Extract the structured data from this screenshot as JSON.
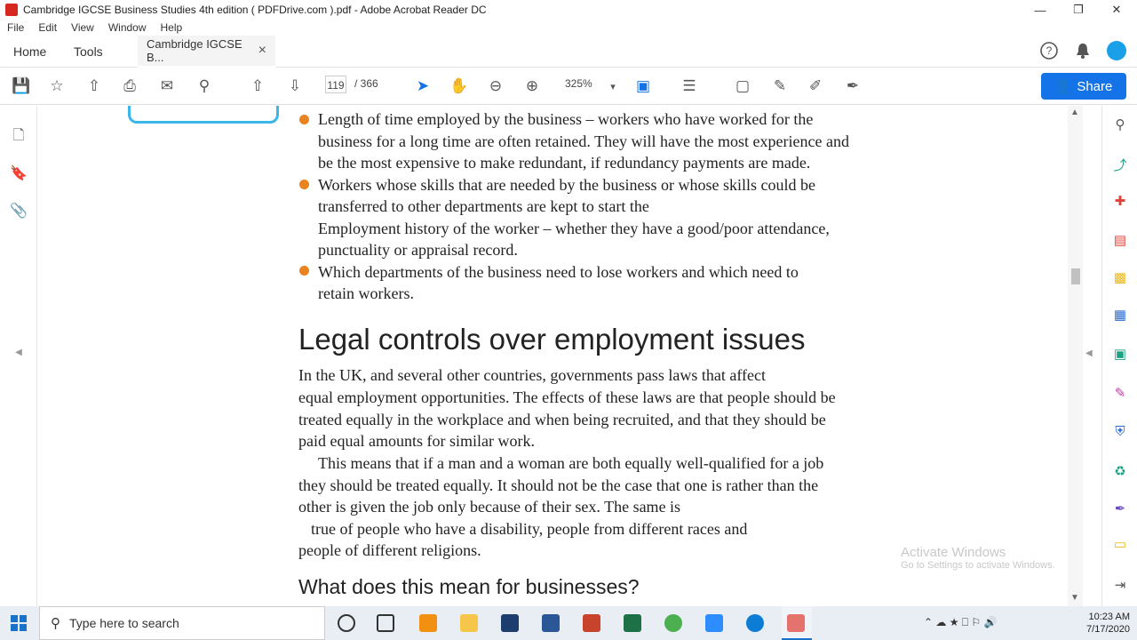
{
  "window": {
    "title": "Cambridge IGCSE Business Studies 4th edition ( PDFDrive.com ).pdf - Adobe Acrobat Reader DC",
    "minimize": "—",
    "restore": "❐",
    "close": "✕"
  },
  "menu": [
    "File",
    "Edit",
    "View",
    "Window",
    "Help"
  ],
  "tabs": {
    "home": "Home",
    "tools": "Tools",
    "document": "Cambridge IGCSE B...",
    "close": "×"
  },
  "toolbar": {
    "page_current": "119",
    "page_total": "/ 366",
    "zoom": "325%",
    "share_label": "Share"
  },
  "document": {
    "bullets": [
      "Length of time employed by the business – workers who have worked for the",
      "business for a long time are often retained. They will have the most experience and",
      "be the most expensive to make redundant, if redundancy payments are made.",
      "Workers whose skills that are needed by the business or whose skills could be",
      "transferred to other departments are kept to start the",
      "Employment history of the worker – whether they have a good/poor attendance,",
      "punctuality or appraisal record.",
      "Which departments of the business need to lose workers and which need to",
      "retain workers."
    ],
    "heading": "Legal controls over employment issues",
    "paragraph1": [
      "In the UK, and several other countries, governments pass laws that affect",
      "equal employment opportunities. The effects of these laws are that people should be",
      "treated equally in the workplace and when being recruited, and that they should be",
      "paid equal amounts for similar work."
    ],
    "paragraph2": [
      "This means that if a man and a woman are both equally well-qualified for a job",
      "they should be treated equally. It should not be the case that one is rather than the",
      "other is given the job only because of their sex. The same is",
      "true of people who have a disability, people from different races and",
      "people of different religions."
    ],
    "subheading": "What does this mean for businesses?"
  },
  "watermark": {
    "line1": "Activate Windows",
    "line2": "Go to Settings to activate Windows."
  },
  "taskbar": {
    "search_placeholder": "Type here to search",
    "time": "10:23 AM",
    "date": "7/17/2020"
  },
  "colors": {
    "accent": "#1473e6",
    "bullet": "#e8831f",
    "acrobat_red": "#d7281f"
  }
}
